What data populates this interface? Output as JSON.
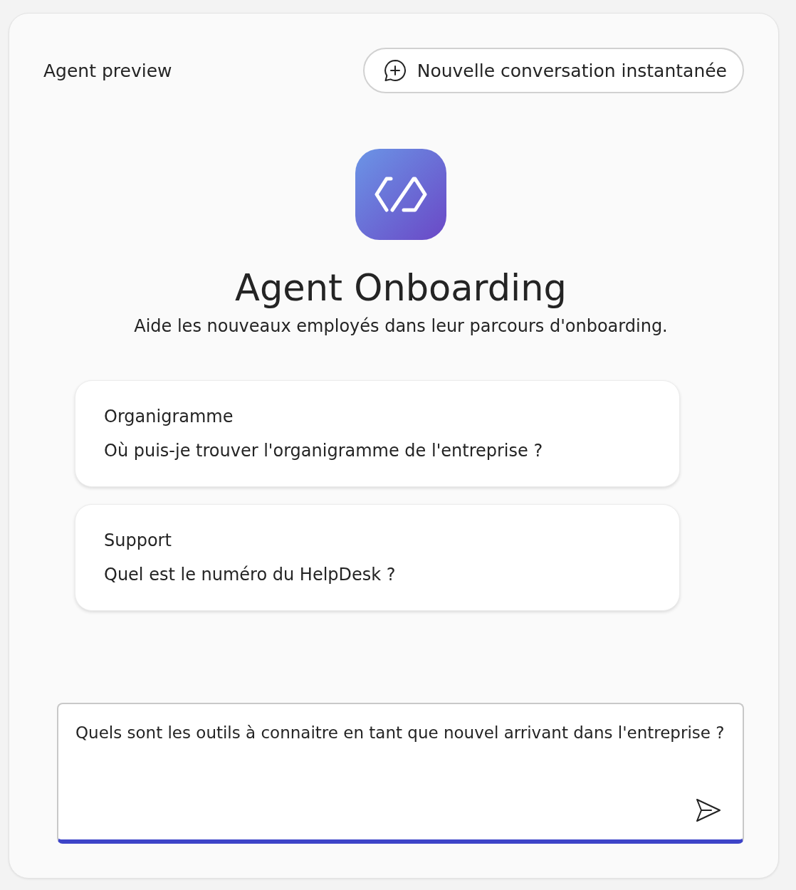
{
  "header": {
    "title": "Agent preview",
    "new_chat_button": "Nouvelle conversation instantanée"
  },
  "agent": {
    "name": "Agent Onboarding",
    "description": "Aide les nouveaux employés dans leur parcours d'onboarding."
  },
  "suggestions": [
    {
      "title": "Organigramme",
      "prompt": "Où puis-je trouver l'organigramme de l'entreprise ?"
    },
    {
      "title": "Support",
      "prompt": "Quel est le numéro du HelpDesk ?"
    }
  ],
  "composer": {
    "value": "Quels sont les outils à connaitre en tant que nouvel arrivant dans l'entreprise ?"
  }
}
